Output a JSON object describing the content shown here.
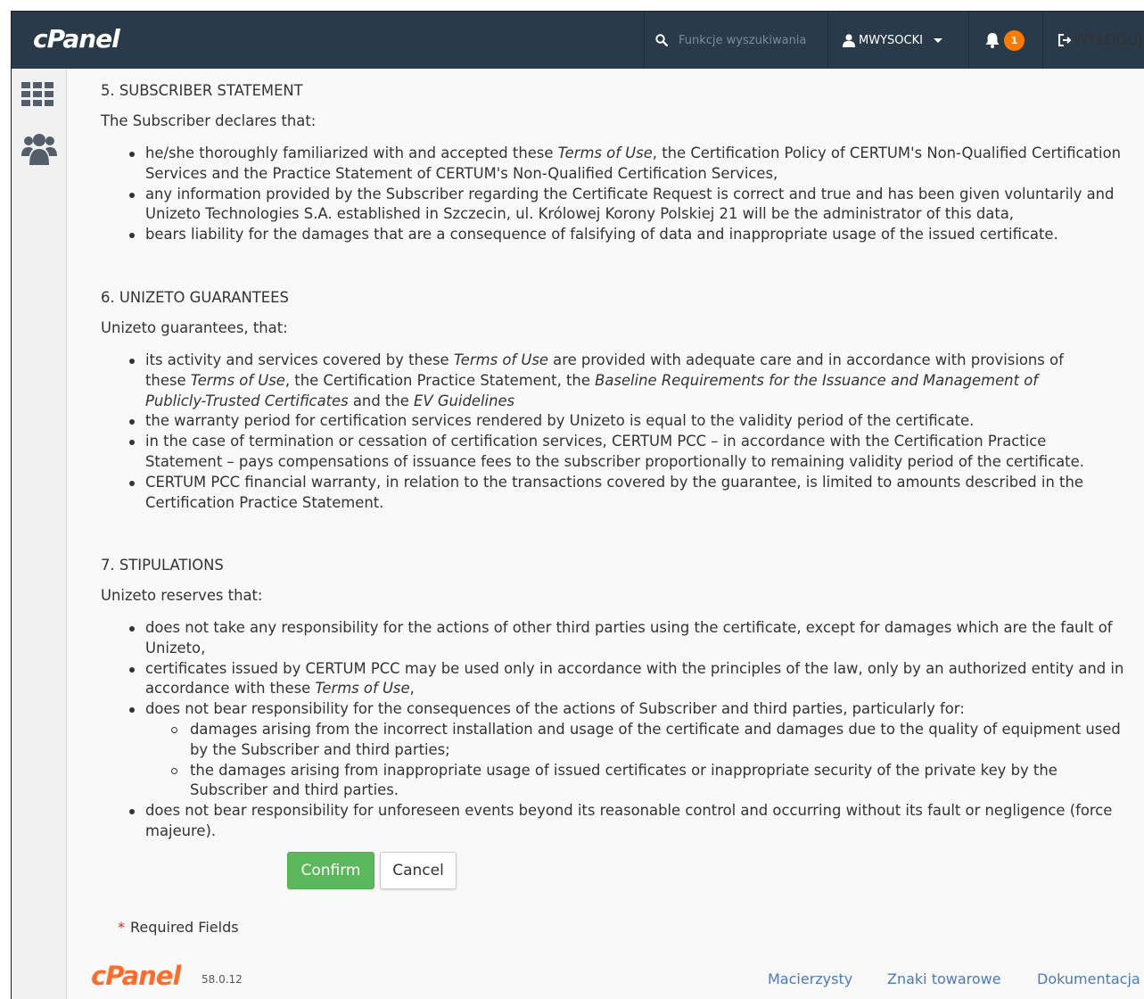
{
  "header": {
    "logo": "cPanel",
    "search_placeholder": "Funkcje wyszukiwania",
    "username": "MWYSOCKI",
    "notification_count": "1",
    "logout_label": "WYLOGUJ"
  },
  "sidebar": {
    "items": [
      {
        "icon": "grid-icon"
      },
      {
        "icon": "users-icon"
      }
    ]
  },
  "sections": {
    "s5": {
      "title": "5. SUBSCRIBER STATEMENT",
      "intro": "The Subscriber declares that:",
      "b1a": "he/she thoroughly familiarized with and accepted these ",
      "b1b": "Terms of Use",
      "b1c": ", the Certification Policy of CERTUM's Non-Qualified Certification Services and the Practice Statement of CERTUM's Non-Qualified Certification Services,",
      "b2": "any information provided by the Subscriber regarding the Certificate Request is correct and true and has been given voluntarily and Unizeto Technologies S.A. established in Szczecin, ul. Królowej Korony Polskiej 21 will be the administrator of this data,",
      "b3": "bears liability for the damages that are a consequence of falsifying of data and inappropriate usage of the issued certificate."
    },
    "s6": {
      "title": "6. UNIZETO GUARANTEES",
      "intro": "Unizeto guarantees, that:",
      "b1a": "its activity and services covered by these ",
      "b1b": "Terms of Use",
      "b1c": " are provided with adequate care and in accordance with provisions of these ",
      "b1d": "Terms of Use",
      "b1e": ", the Certification Practice Statement, the ",
      "b1f": "Baseline Requirements for the Issuance and Management of Publicly-Trusted Certificates",
      "b1g": " and the ",
      "b1h": "EV Guidelines",
      "b2": "the warranty period for certification services rendered by Unizeto is equal to the validity period of the certificate.",
      "b3": "in the case of termination or cessation of certification services, CERTUM PCC – in accordance with the Certification Practice Statement – pays compensations of issuance fees to the subscriber proportionally to remaining validity period of the certificate.",
      "b4": "CERTUM PCC  financial warranty, in relation to the transactions covered by the guarantee, is limited to amounts described in the Certification Practice Statement."
    },
    "s7": {
      "title": "7. STIPULATIONS",
      "intro": "Unizeto reserves that:",
      "b1": "does not take any responsibility for the actions of other third parties using the certificate, except for damages which are the fault of Unizeto,",
      "b2a": "certificates issued by CERTUM PCC may be used only in accordance with the principles of the law, only by an authorized entity and in accordance with these ",
      "b2b": "Terms of Use",
      "b2c": ",",
      "b3": "does not bear responsibility for the consequences of the actions of Subscriber and third parties, particularly for:",
      "sub1": "damages arising from the incorrect installation and usage of the certificate and damages due to the quality of equipment used by the Subscriber and third parties;",
      "sub2": "the damages arising from inappropriate usage of issued certificates or inappropriate security of the private key by the Subscriber and third parties.",
      "b4": "does not bear responsibility for unforeseen events beyond its reasonable control and occurring without its fault or negligence (force majeure)."
    }
  },
  "actions": {
    "confirm_label": "Confirm",
    "cancel_label": "Cancel"
  },
  "required_note": {
    "star": "*",
    "text": "Required Fields"
  },
  "footer": {
    "logo": "cPanel",
    "version": "58.0.12",
    "links": [
      "Macierzysty",
      "Znaki towarowe",
      "Dokumentacja"
    ]
  },
  "colors": {
    "topbar": "#293a4a",
    "badge": "#ff7a00",
    "confirm": "#5cb85c",
    "link": "#4a7ab8",
    "footer_logo": "#ff6c2c"
  }
}
